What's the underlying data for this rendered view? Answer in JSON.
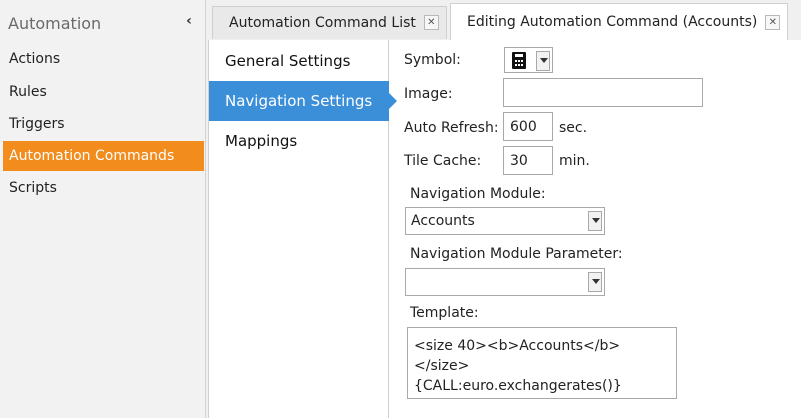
{
  "sidebar": {
    "title": "Automation",
    "collapse_glyph": "‹",
    "items": [
      {
        "label": "Actions"
      },
      {
        "label": "Rules"
      },
      {
        "label": "Triggers"
      },
      {
        "label": "Automation Commands",
        "active": true
      },
      {
        "label": "Scripts"
      }
    ]
  },
  "tabs": [
    {
      "label": "Automation Command List",
      "close": "✕"
    },
    {
      "label": "Editing Automation Command (Accounts)",
      "close": "✕",
      "active": true
    }
  ],
  "settings_nav": [
    {
      "label": "General Settings"
    },
    {
      "label": "Navigation Settings",
      "active": true
    },
    {
      "label": "Mappings"
    }
  ],
  "form": {
    "symbol_label": "Symbol:",
    "symbol_icon": "calculator-icon",
    "image_label": "Image:",
    "image_value": "",
    "auto_refresh_label": "Auto Refresh:",
    "auto_refresh_value": "600",
    "auto_refresh_unit": "sec.",
    "tile_cache_label": "Tile Cache:",
    "tile_cache_value": "30",
    "tile_cache_unit": "min.",
    "nav_module_label": "Navigation Module:",
    "nav_module_value": "Accounts",
    "nav_param_label": "Navigation Module Parameter:",
    "nav_param_value": "",
    "template_label": "Template:",
    "template_value": "<size 40><b>Accounts</b></size>\n{CALL:euro.exchangerates()}"
  },
  "colors": {
    "accent_orange": "#f28c1c",
    "accent_blue": "#3b8ed8"
  }
}
